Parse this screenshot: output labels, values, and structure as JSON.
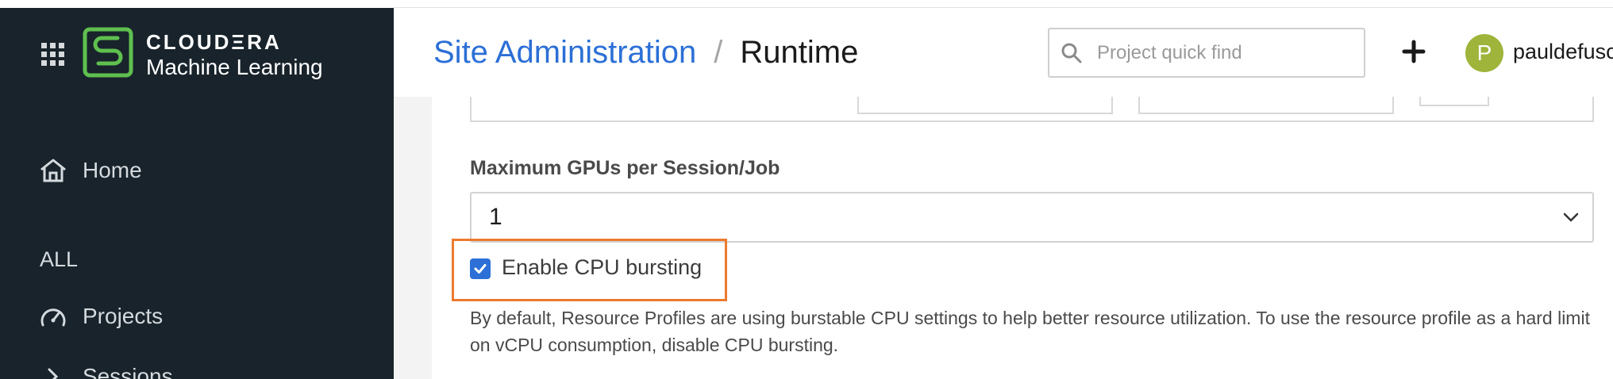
{
  "sidebar": {
    "brand_top": "CLOUDΞRA",
    "brand_sub": "Machine Learning",
    "nav": {
      "home": "Home",
      "all": "ALL",
      "projects": "Projects",
      "sessions": "Sessions"
    }
  },
  "header": {
    "breadcrumb_parent": "Site Administration",
    "breadcrumb_separator": "/",
    "breadcrumb_current": "Runtime",
    "search_placeholder": "Project quick find",
    "avatar_letter": "P",
    "username": "pauldefusc"
  },
  "form": {
    "gpu_label": "Maximum GPUs per Session/Job",
    "gpu_value": "1",
    "cpu_bursting_label": "Enable CPU bursting",
    "cpu_bursting_checked": true,
    "description": "By default, Resource Profiles are using burstable CPU settings to help better resource utilization. To use the resource profile as a hard limit on vCPU consumption, disable CPU bursting."
  },
  "colors": {
    "sidebar_bg": "#18232b",
    "link": "#2c6fd6",
    "highlight": "#ec7a2f",
    "avatar": "#9eb43a",
    "logo_green": "#5fbf4f"
  }
}
